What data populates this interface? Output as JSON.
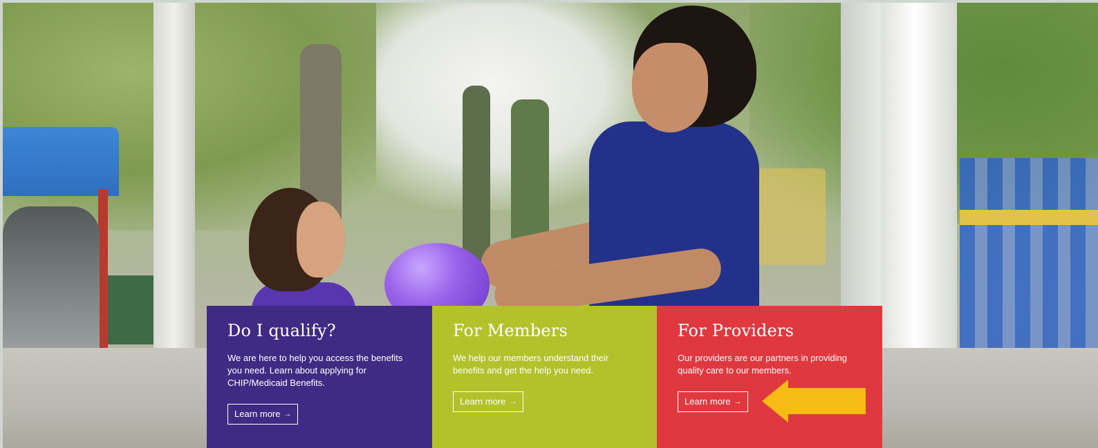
{
  "panels": {
    "qualify": {
      "title": "Do I qualify?",
      "description": "We are here to help you access the benefits you need. Learn about applying for CHIP/Medicaid Benefits.",
      "button_label": "Learn more",
      "color": "#3f2b83"
    },
    "members": {
      "title": "For Members",
      "description": "We help our members understand their benefits and get the help you need.",
      "button_label": "Learn more",
      "color": "#b3c22b"
    },
    "providers": {
      "title": "For Providers",
      "description": "Our providers are our partners in providing quality care to our members.",
      "button_label": "Learn more",
      "color": "#e0383f"
    }
  },
  "button_arrow": "→",
  "callout": {
    "icon": "left-arrow-icon",
    "color": "#f7bb16"
  }
}
